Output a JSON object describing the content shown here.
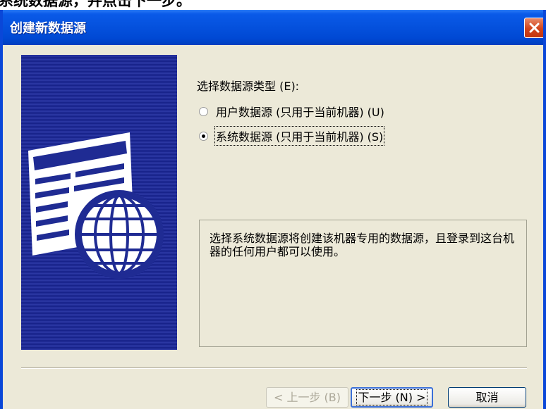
{
  "caption": {
    "text": "系统数据源，并点击下一步。"
  },
  "window": {
    "title": "创建新数据源",
    "close_label": "✕"
  },
  "datasource_type": {
    "label": "选择数据源类型 (E):",
    "selected": "system",
    "options": [
      {
        "id": "user",
        "label": "用户数据源 (只用于当前机器) (U)",
        "checked": false
      },
      {
        "id": "system",
        "label": "系统数据源 (只用于当前机器) (S)",
        "checked": true
      }
    ]
  },
  "description": "选择系统数据源将创建该机器专用的数据源，且登录到这台机器的任何用户都可以使用。",
  "buttons": {
    "back": "< 上一步 (B)",
    "next": "下一步 (N) >",
    "cancel": "取消"
  },
  "colors": {
    "titlebar": "#0552de",
    "dialog_bg": "#ece9d8",
    "side_panel": "#1f2b93"
  },
  "icons": {
    "wizard_graphic": "table-globe-icon",
    "close": "close-icon"
  }
}
